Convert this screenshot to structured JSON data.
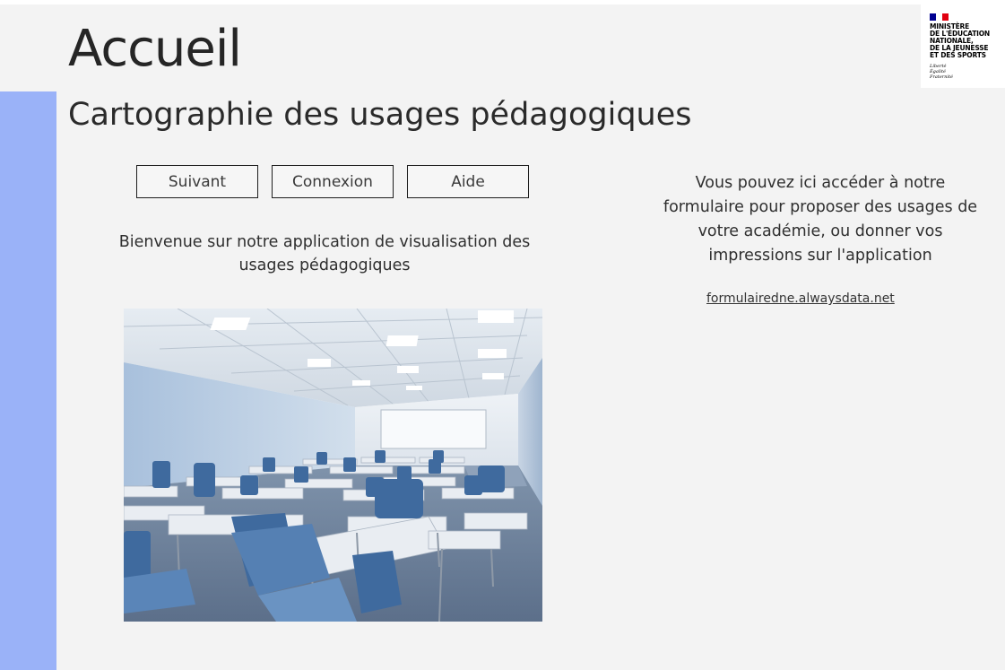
{
  "header": {
    "title": "Accueil",
    "subtitle": "Cartographie des usages pédagogiques"
  },
  "logo": {
    "line1": "MINISTÈRE",
    "line2": "DE L'ÉDUCATION",
    "line3": "NATIONALE,",
    "line4": "DE LA JEUNESSE",
    "line5": "ET DES SPORTS",
    "motto1": "Liberté",
    "motto2": "Égalité",
    "motto3": "Fraternité"
  },
  "buttons": {
    "next": "Suivant",
    "login": "Connexion",
    "help": "Aide"
  },
  "welcome": "Bienvenue sur notre application de visualisation des usages pédagogiques",
  "right": {
    "text": "Vous pouvez ici accéder à notre formulaire pour proposer des usages de votre académie, ou donner vos impressions sur l'application",
    "link": "formulairedne.alwaysdata.net"
  },
  "colors": {
    "side_band": "#9ab2f8",
    "background": "#f3f3f3"
  }
}
